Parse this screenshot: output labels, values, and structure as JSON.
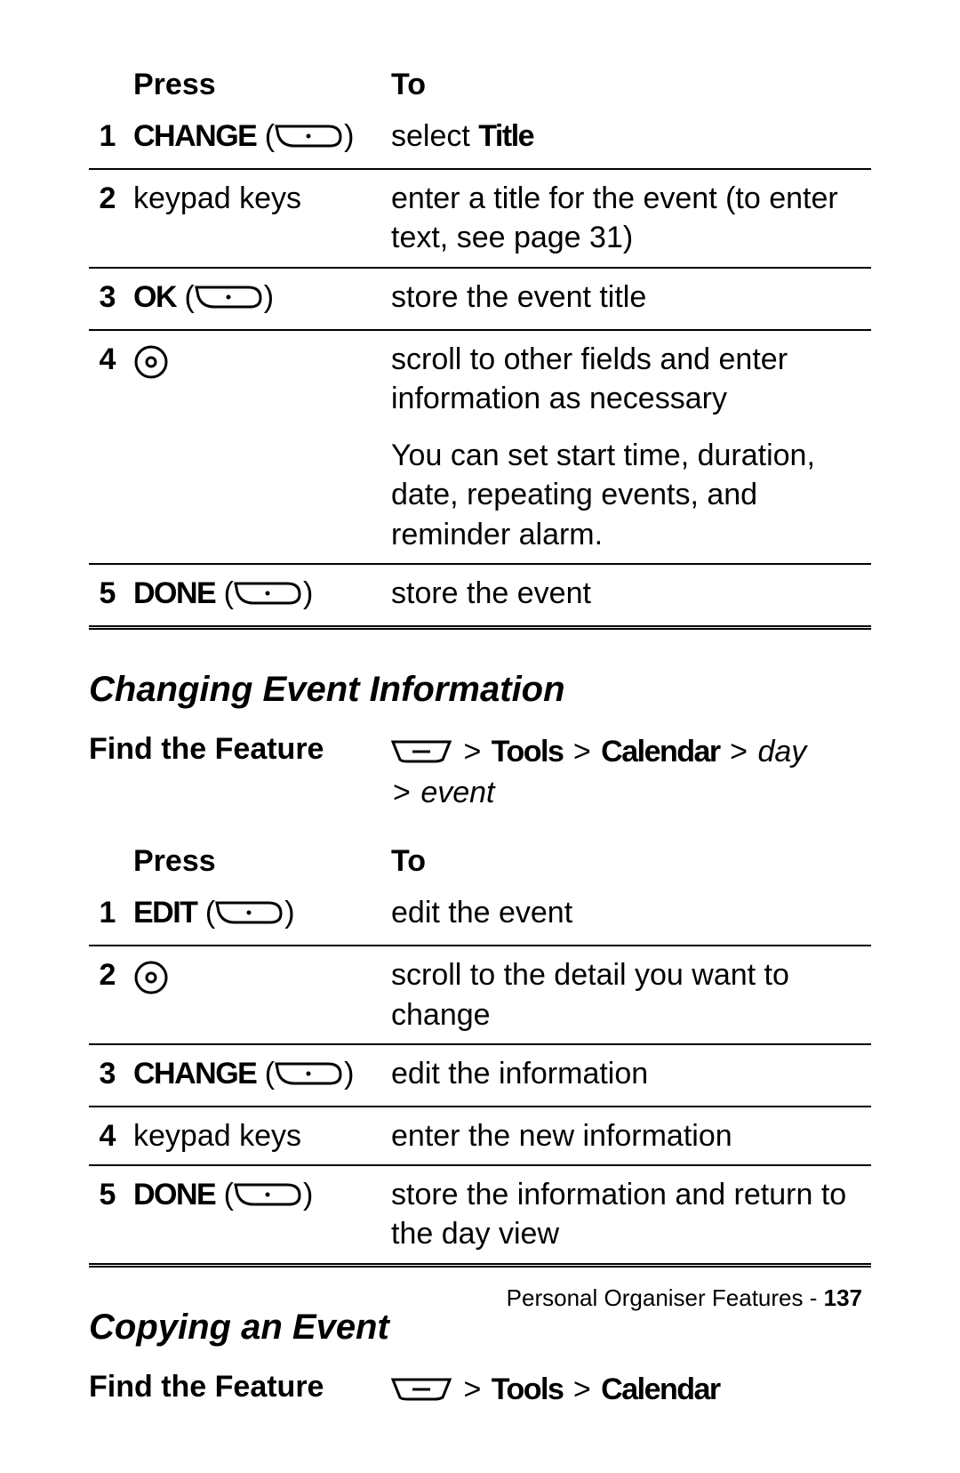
{
  "table1": {
    "head_press": "Press",
    "head_to": "To",
    "rows": [
      {
        "n": "1",
        "press_label": "CHANGE",
        "press_plain": "",
        "to_pre": "select ",
        "to_cond": "Title",
        "to_post": "",
        "soft": true
      },
      {
        "n": "2",
        "press_label": "",
        "press_plain": "keypad keys",
        "to_pre": "enter a title for the event (to enter text, see page 31)",
        "to_cond": "",
        "to_post": ""
      },
      {
        "n": "3",
        "press_label": "OK",
        "press_plain": "",
        "to_pre": "store the event title",
        "to_cond": "",
        "to_post": "",
        "soft": true
      },
      {
        "n": "4",
        "press_label": "",
        "press_plain": "",
        "nav": true,
        "to_pre": "scroll to other fields and enter information as necessary",
        "to_cond": "",
        "to_post": ""
      }
    ],
    "extra_row_to": "You can set start time, duration, date, repeating events, and reminder alarm.",
    "last": {
      "n": "5",
      "press_label": "DONE",
      "to": "store the event",
      "soft": true
    }
  },
  "section1": "Changing Event Information",
  "find1": {
    "label": "Find the Feature",
    "tools": "Tools",
    "cal": "Calendar",
    "day": "day",
    "event": "event"
  },
  "table2": {
    "head_press": "Press",
    "head_to": "To",
    "rows": [
      {
        "n": "1",
        "press_label": "EDIT",
        "press_plain": "",
        "to": "edit the event",
        "soft": true
      },
      {
        "n": "2",
        "press_label": "",
        "press_plain": "",
        "nav": true,
        "to": "scroll to the detail you want to change"
      },
      {
        "n": "3",
        "press_label": "CHANGE",
        "press_plain": "",
        "to": "edit the information",
        "soft": true
      },
      {
        "n": "4",
        "press_label": "",
        "press_plain": "keypad keys",
        "to": "enter the new information"
      }
    ],
    "last": {
      "n": "5",
      "press_label": "DONE",
      "to": "store the information and return to the day view",
      "soft": true
    }
  },
  "section2": "Copying an Event",
  "find2": {
    "label": "Find the Feature",
    "tools": "Tools",
    "cal": "Calendar"
  },
  "footer": {
    "text": "Personal Organiser Features - ",
    "page": "137"
  },
  "gt": ">"
}
